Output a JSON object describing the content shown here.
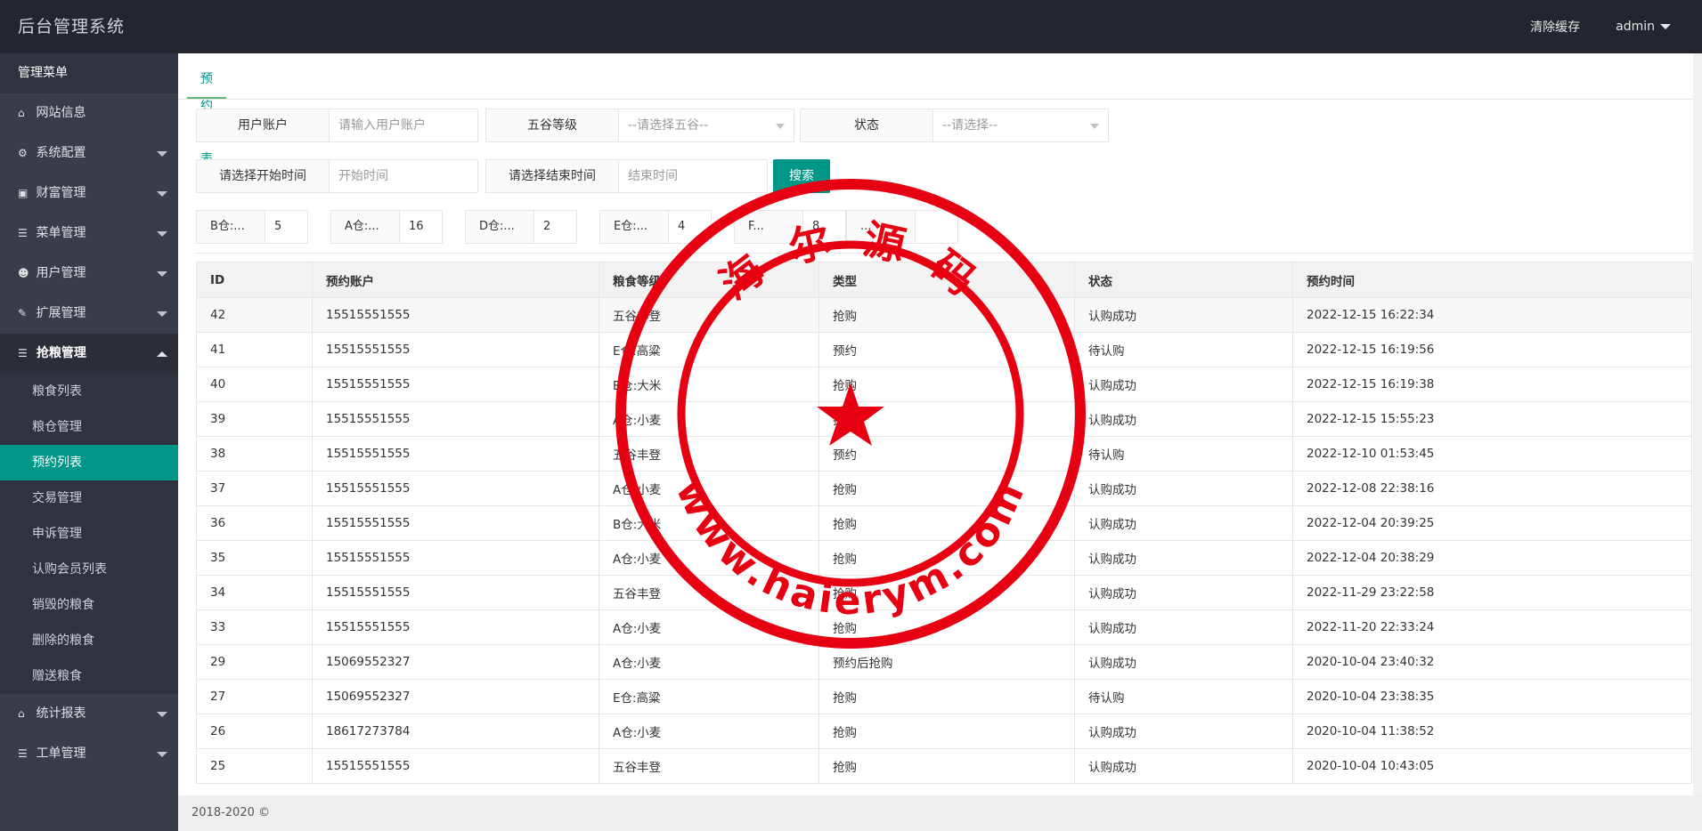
{
  "app": {
    "title": "后台管理系统"
  },
  "header": {
    "clear_cache": "清除缓存",
    "user": "admin"
  },
  "sidebar": {
    "title": "管理菜单",
    "items": [
      {
        "label": "网站信息",
        "icon": "home-icon"
      },
      {
        "label": "系统配置",
        "icon": "gears-icon"
      },
      {
        "label": "财富管理",
        "icon": "money-icon"
      },
      {
        "label": "菜单管理",
        "icon": "list-icon"
      },
      {
        "label": "用户管理",
        "icon": "users-icon"
      },
      {
        "label": "扩展管理",
        "icon": "wrench-icon"
      },
      {
        "label": "抢粮管理",
        "icon": "list-icon"
      },
      {
        "label": "统计报表",
        "icon": "home-icon"
      },
      {
        "label": "工单管理",
        "icon": "list-icon"
      }
    ],
    "sub_items": [
      "粮食列表",
      "粮仓管理",
      "预约列表",
      "交易管理",
      "申诉管理",
      "认购会员列表",
      "销毁的粮食",
      "删除的粮食",
      "赠送粮食"
    ]
  },
  "tab": {
    "label": "预约列表"
  },
  "filters": {
    "account_label": "用户账户",
    "account_placeholder": "请输入用户账户",
    "grade_label": "五谷等级",
    "grade_value": "--请选择五谷--",
    "status_label": "状态",
    "status_value": "--请选择--",
    "start_label": "请选择开始时间",
    "start_placeholder": "开始时间",
    "end_label": "请选择结束时间",
    "end_placeholder": "结束时间",
    "search_button": "搜索"
  },
  "stats": [
    {
      "label": "B仓:...",
      "value": "5"
    },
    {
      "label": "A仓:...",
      "value": "16"
    },
    {
      "label": "D仓:...",
      "value": "2"
    },
    {
      "label": "E仓:...",
      "value": "4"
    },
    {
      "label": "F...",
      "value": "8"
    },
    {
      "label": "...",
      "value": ""
    }
  ],
  "table": {
    "headers": [
      "ID",
      "预约账户",
      "粮食等级",
      "类型",
      "状态",
      "预约时间"
    ],
    "rows": [
      [
        "42",
        "15515551555",
        "五谷丰登",
        "抢购",
        "认购成功",
        "2022-12-15 16:22:34"
      ],
      [
        "41",
        "15515551555",
        "E仓:高粱",
        "预约",
        "待认购",
        "2022-12-15 16:19:56"
      ],
      [
        "40",
        "15515551555",
        "B仓:大米",
        "抢购",
        "认购成功",
        "2022-12-15 16:19:38"
      ],
      [
        "39",
        "15515551555",
        "A仓:小麦",
        "抢购",
        "认购成功",
        "2022-12-15 15:55:23"
      ],
      [
        "38",
        "15515551555",
        "五谷丰登",
        "预约",
        "待认购",
        "2022-12-10 01:53:45"
      ],
      [
        "37",
        "15515551555",
        "A仓:小麦",
        "抢购",
        "认购成功",
        "2022-12-08 22:38:16"
      ],
      [
        "36",
        "15515551555",
        "B仓:大米",
        "抢购",
        "认购成功",
        "2022-12-04 20:39:25"
      ],
      [
        "35",
        "15515551555",
        "A仓:小麦",
        "抢购",
        "认购成功",
        "2022-12-04 20:38:29"
      ],
      [
        "34",
        "15515551555",
        "五谷丰登",
        "抢购",
        "认购成功",
        "2022-11-29 23:22:58"
      ],
      [
        "33",
        "15515551555",
        "A仓:小麦",
        "抢购",
        "认购成功",
        "2022-11-20 22:33:24"
      ],
      [
        "29",
        "15069552327",
        "A仓:小麦",
        "预约后抢购",
        "认购成功",
        "2020-10-04 23:40:32"
      ],
      [
        "27",
        "15069552327",
        "E仓:高粱",
        "抢购",
        "待认购",
        "2020-10-04 23:38:35"
      ],
      [
        "26",
        "18617273784",
        "A仓:小麦",
        "抢购",
        "认购成功",
        "2020-10-04 11:38:52"
      ],
      [
        "25",
        "15515551555",
        "五谷丰登",
        "抢购",
        "认购成功",
        "2020-10-04 10:43:05"
      ]
    ]
  },
  "footer": {
    "copyright": "2018-2020 ©"
  },
  "watermark": {
    "top_text": "海 尔 源 码",
    "bottom_text": "www.haierym.com",
    "color": "#e60012"
  }
}
